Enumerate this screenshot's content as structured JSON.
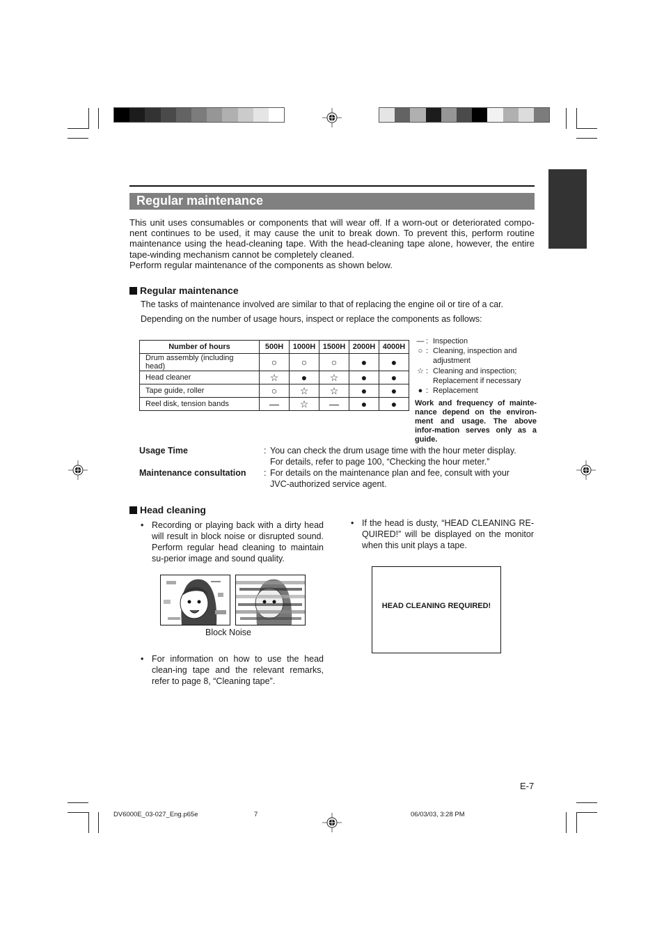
{
  "print_marks": {
    "color_bar_left": [
      "#000000",
      "#1c1c1c",
      "#333333",
      "#4a4a4a",
      "#636363",
      "#7c7c7c",
      "#969696",
      "#b0b0b0",
      "#cbcbcb",
      "#e5e5e5",
      "#ffffff"
    ],
    "color_bar_right": [
      "#e5e5e5",
      "#636363",
      "#b0b0b0",
      "#1c1c1c",
      "#969696",
      "#4a4a4a",
      "#000000",
      "#f2f2f2",
      "#b0b0b0",
      "#dcdcdc",
      "#7c7c7c"
    ]
  },
  "section": {
    "title": "Regular maintenance",
    "intro_lines": [
      "This unit uses consumables or components that will wear off. If a worn-out or deteriorated compo-nent continues to be used, it may cause the unit to break down. To prevent this, perform routine maintenance using the head-cleaning tape. With the head-cleaning tape alone, however, the entire tape-winding mechanism cannot be completely cleaned.",
      "Perform regular maintenance of the components as shown below."
    ]
  },
  "regular": {
    "heading": "Regular maintenance",
    "line1": "The tasks of maintenance involved are similar to that of replacing the engine oil or tire of a car.",
    "line2": "Depending on the number of usage hours, inspect or replace the components as follows:",
    "table": {
      "header": [
        "Number of hours",
        "500H",
        "1000H",
        "1500H",
        "2000H",
        "4000H"
      ],
      "rows": [
        {
          "label": "Drum assembly (including head)",
          "cells": [
            "○",
            "○",
            "○",
            "●",
            "●"
          ]
        },
        {
          "label": "Head cleaner",
          "cells": [
            "☆",
            "●",
            "☆",
            "●",
            "●"
          ]
        },
        {
          "label": "Tape guide, roller",
          "cells": [
            "○",
            "☆",
            "☆",
            "●",
            "●"
          ]
        },
        {
          "label": "Reel disk, tension bands",
          "cells": [
            "—",
            "☆",
            "—",
            "●",
            "●"
          ]
        }
      ]
    },
    "legend": [
      {
        "symbol": "—",
        "text": "Inspection"
      },
      {
        "symbol": "○",
        "text": "Cleaning, inspection and adjustment"
      },
      {
        "symbol": "☆",
        "text": "Cleaning and inspection; Replacement if necessary"
      },
      {
        "symbol": "●",
        "text": "Replacement"
      }
    ],
    "legend_note": "Work and frequency of mainte-nance depend on the environ-ment and usage. The above infor-mation serves only as a guide."
  },
  "info": {
    "usage_label": "Usage Time",
    "usage_text": "You can check the drum usage time with the hour meter display. For details, refer to page 100, “Checking the hour meter.”",
    "consult_label": "Maintenance consultation",
    "consult_text": "For details on the maintenance plan and fee, consult with your JVC-authorized service agent.",
    "colon": ":"
  },
  "head_cleaning": {
    "heading": "Head cleaning",
    "bullet1": "Recording or playing back with a dirty head will result in block noise or disrupted sound. Perform regular head cleaning to maintain su-perior image and sound quality.",
    "bullet2": "For information on how to use the head clean-ing tape and the relevant remarks, refer to page 8, “Cleaning tape”.",
    "bullet3": "If the head is dusty, “HEAD CLEANING RE-QUIRED!” will be displayed on the monitor when this unit plays a tape.",
    "caption": "Block Noise",
    "monitor_text": "HEAD CLEANING REQUIRED!",
    "bullet_char": "•"
  },
  "page_number": "E-7",
  "footer": {
    "file": "DV6000E_03-027_Eng.p65e",
    "page": "7",
    "date": "06/03/03, 3:28 PM"
  }
}
